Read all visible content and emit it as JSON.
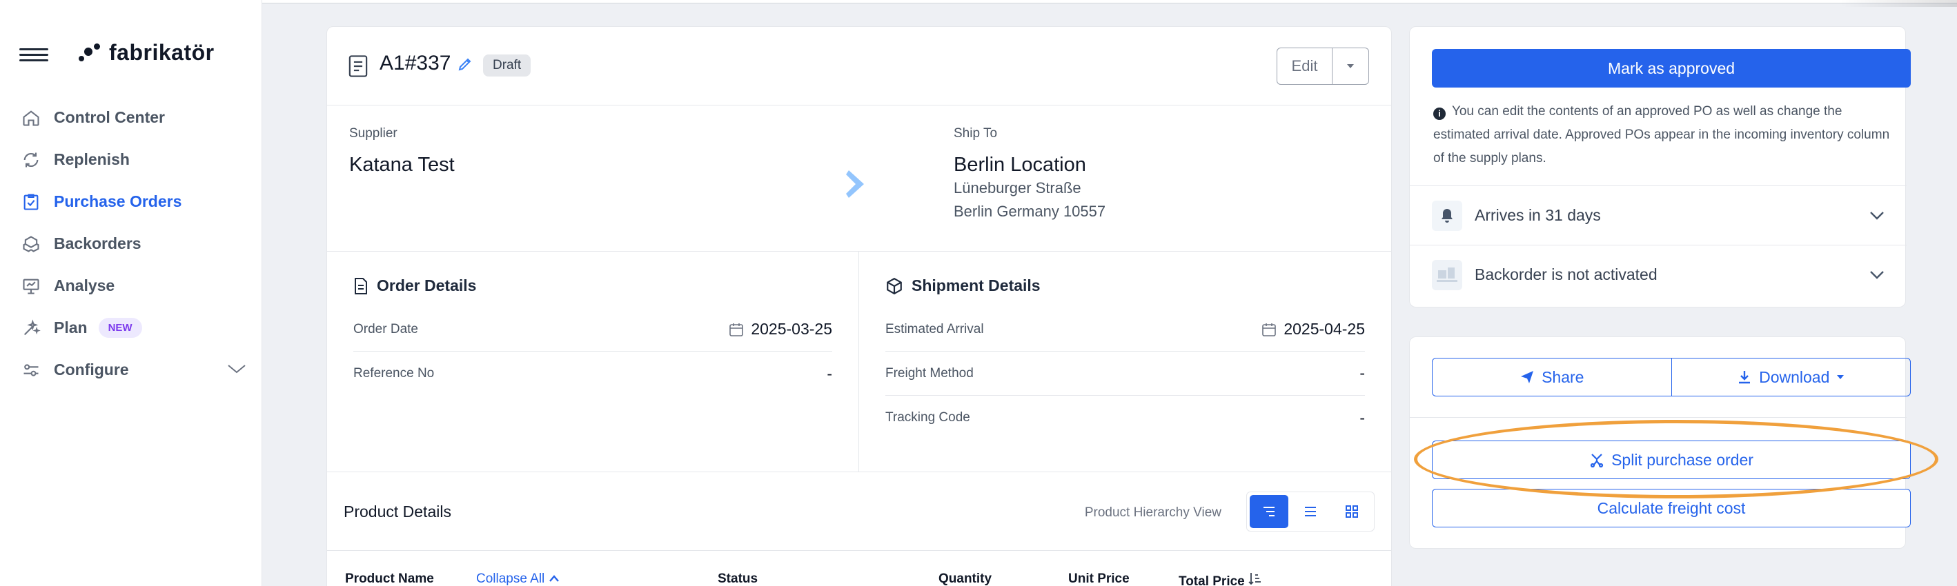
{
  "app": {
    "logo_text": "fabrikatör"
  },
  "sidebar": {
    "items": [
      {
        "label": "Control Center",
        "icon": "home-icon"
      },
      {
        "label": "Replenish",
        "icon": "refresh-icon"
      },
      {
        "label": "Purchase Orders",
        "icon": "clipboard-check-icon",
        "active": true
      },
      {
        "label": "Backorders",
        "icon": "boxes-icon"
      },
      {
        "label": "Analyse",
        "icon": "presentation-icon"
      },
      {
        "label": "Plan",
        "icon": "sparkle-icon",
        "badge": "NEW"
      },
      {
        "label": "Configure",
        "icon": "sliders-icon"
      }
    ]
  },
  "po": {
    "title": "A1#337",
    "status": "Draft",
    "edit_label": "Edit",
    "supplier_label": "Supplier",
    "supplier_name": "Katana Test",
    "shipto_label": "Ship To",
    "shipto_name": "Berlin Location",
    "shipto_street": "Lüneburger Straße",
    "shipto_city": "Berlin Germany 10557"
  },
  "order_details": {
    "title": "Order Details",
    "order_date_label": "Order Date",
    "order_date": "2025-03-25",
    "reference_label": "Reference No",
    "reference": "-"
  },
  "shipment_details": {
    "title": "Shipment Details",
    "arrival_label": "Estimated Arrival",
    "arrival": "2025-04-25",
    "freight_label": "Freight Method",
    "freight": "-",
    "tracking_label": "Tracking Code",
    "tracking": "-"
  },
  "products": {
    "title": "Product Details",
    "view_label": "Product Hierarchy View",
    "columns": {
      "name": "Product Name",
      "collapse": "Collapse All",
      "status": "Status",
      "quantity": "Quantity",
      "unit_price": "Unit Price",
      "total_price": "Total Price"
    }
  },
  "actions": {
    "approve": "Mark as approved",
    "info": "You can edit the contents of an approved PO as well as change the estimated arrival date. Approved POs appear in the incoming inventory column of the supply plans.",
    "arrives": "Arrives in 31 days",
    "backorder": "Backorder is not activated",
    "share": "Share",
    "download": "Download",
    "split": "Split purchase order",
    "freight_cost": "Calculate freight cost"
  },
  "colors": {
    "accent": "#2563eb",
    "highlight": "#f0a03c"
  }
}
